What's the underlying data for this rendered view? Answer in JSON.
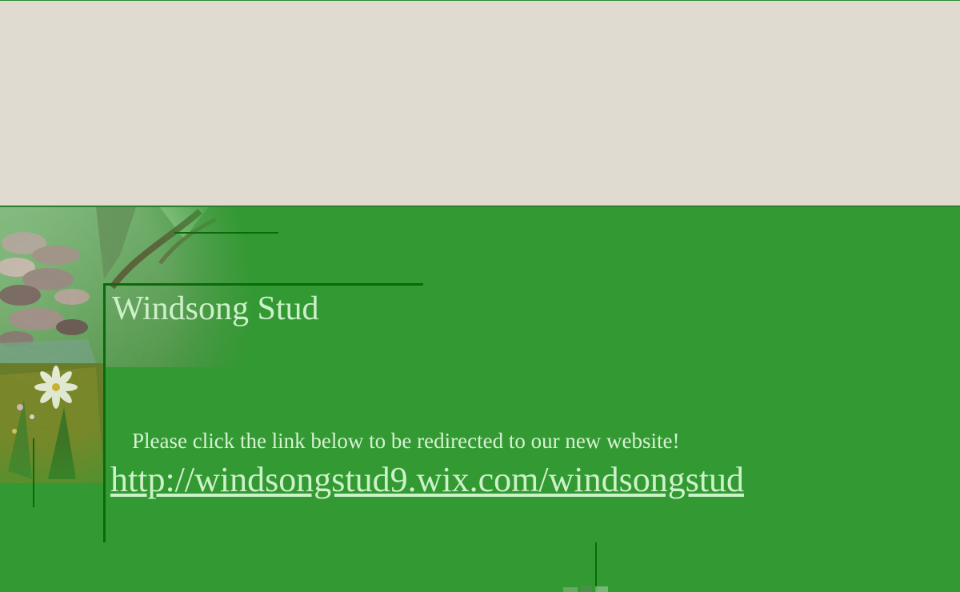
{
  "header": {
    "band_color": "#e0dbd0"
  },
  "main": {
    "background_color": "#339933",
    "title": "Windsong Stud",
    "message": "Please click the link below to be redirected to our new website!",
    "redirect_link": "http://windsongstud9.wix.com/windsongstud"
  },
  "decor": {
    "collage_icon": "nature-collage-image",
    "line_color": "#0b6a0b"
  }
}
